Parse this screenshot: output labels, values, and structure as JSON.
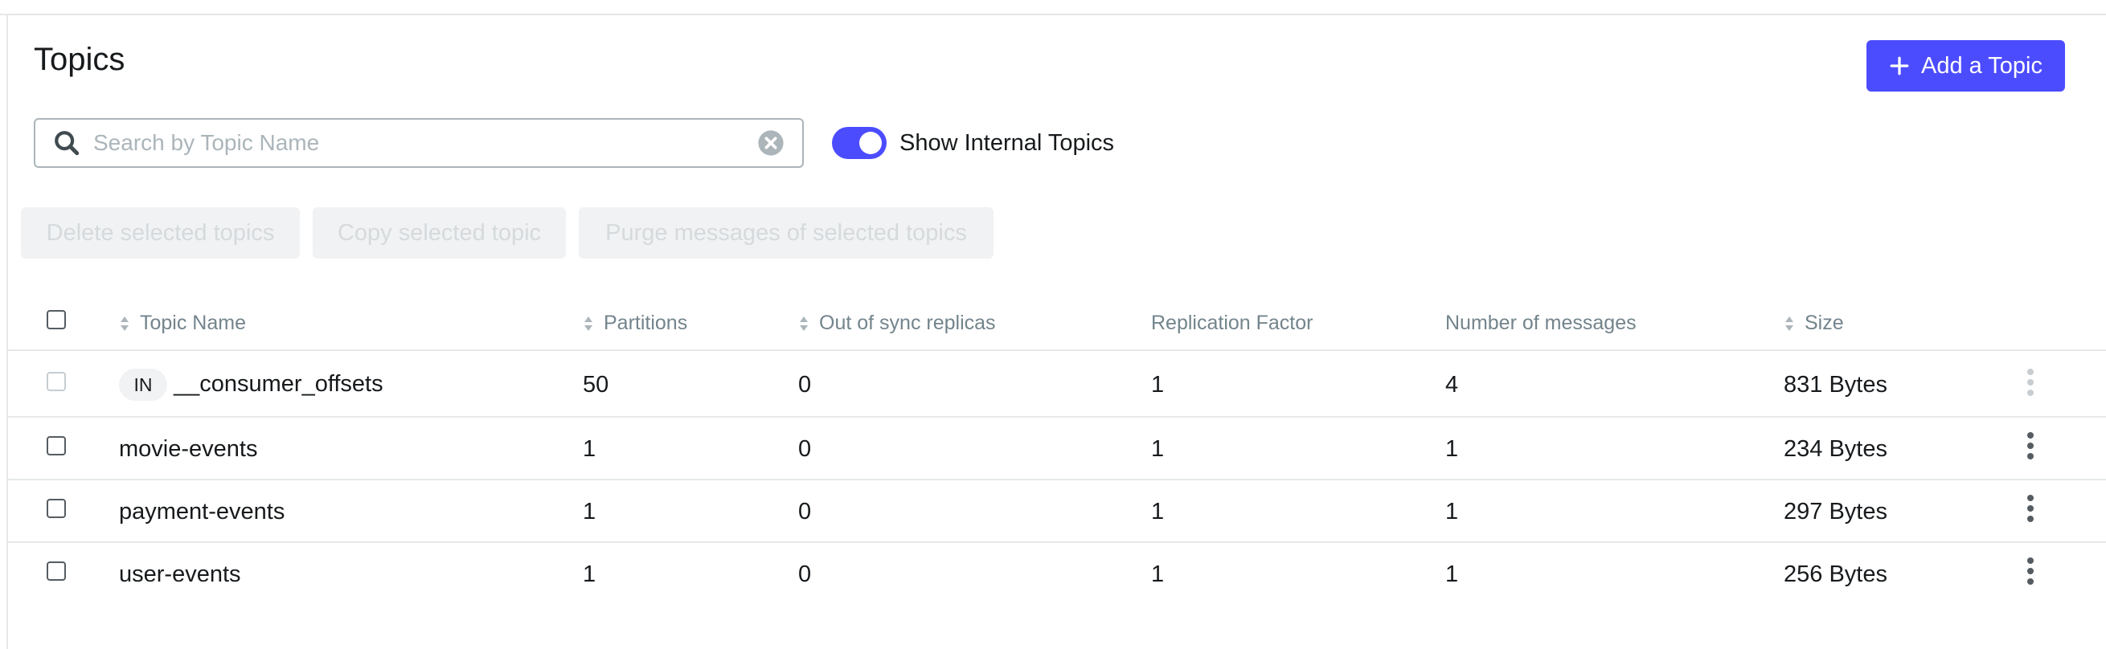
{
  "page": {
    "title": "Topics",
    "add_button_label": "Add a Topic"
  },
  "search": {
    "placeholder": "Search by Topic Name",
    "value": ""
  },
  "toggle": {
    "label": "Show Internal Topics",
    "checked": true
  },
  "bulk_actions": [
    "Delete selected topics",
    "Copy selected topic",
    "Purge messages of selected topics"
  ],
  "table": {
    "columns": [
      "Topic Name",
      "Partitions",
      "Out of sync replicas",
      "Replication Factor",
      "Number of messages",
      "Size"
    ],
    "rows": [
      {
        "internal_badge": "IN",
        "name": "__consumer_offsets",
        "partitions": "50",
        "out_of_sync": "0",
        "replication": "1",
        "messages": "4",
        "size": "831 Bytes"
      },
      {
        "name": "movie-events",
        "partitions": "1",
        "out_of_sync": "0",
        "replication": "1",
        "messages": "1",
        "size": "234 Bytes"
      },
      {
        "name": "payment-events",
        "partitions": "1",
        "out_of_sync": "0",
        "replication": "1",
        "messages": "1",
        "size": "297 Bytes"
      },
      {
        "name": "user-events",
        "partitions": "1",
        "out_of_sync": "0",
        "replication": "1",
        "messages": "1",
        "size": "256 Bytes"
      }
    ]
  },
  "colors": {
    "accent": "#4c4cff",
    "disabled_bg": "#f1f2f3",
    "disabled_text": "#d5dadd",
    "muted": "#73848c"
  },
  "icons": [
    "plus-icon",
    "search-icon",
    "clear-icon",
    "sort-icon",
    "more-vertical-icon"
  ]
}
